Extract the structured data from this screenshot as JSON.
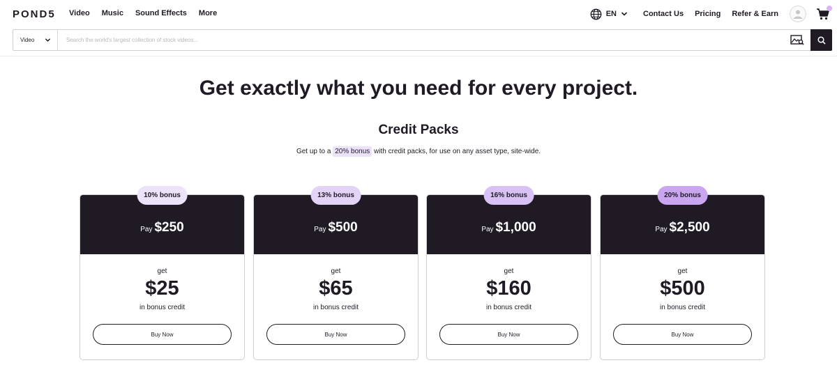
{
  "header": {
    "logo": "POND5",
    "nav": [
      "Video",
      "Music",
      "Sound Effects",
      "More"
    ],
    "language": "EN",
    "links": [
      "Contact Us",
      "Pricing",
      "Refer & Earn"
    ]
  },
  "search": {
    "type": "Video",
    "placeholder": "Search the world's largest collection of stock videos..."
  },
  "main": {
    "title": "Get exactly what you need for every project.",
    "section_title": "Credit Packs",
    "subtitle_pre": "Get up to a ",
    "subtitle_highlight": "20% bonus",
    "subtitle_post": " with credit packs, for use on any asset type, site-wide."
  },
  "cards": [
    {
      "badge": "10% bonus",
      "pay_label": "Pay",
      "pay": "$250",
      "get_label": "get",
      "bonus": "$25",
      "bonus_label": "in bonus credit",
      "button": "Buy Now",
      "badge_color": "#ece3fb"
    },
    {
      "badge": "13% bonus",
      "pay_label": "Pay",
      "pay": "$500",
      "get_label": "get",
      "bonus": "$65",
      "bonus_label": "in bonus credit",
      "button": "Buy Now",
      "badge_color": "#e3d4f7"
    },
    {
      "badge": "16% bonus",
      "pay_label": "Pay",
      "pay": "$1,000",
      "get_label": "get",
      "bonus": "$160",
      "bonus_label": "in bonus credit",
      "button": "Buy Now",
      "badge_color": "#d8c1f4"
    },
    {
      "badge": "20% bonus",
      "pay_label": "Pay",
      "pay": "$2,500",
      "get_label": "get",
      "bonus": "$500",
      "bonus_label": "in bonus credit",
      "button": "Buy Now",
      "badge_color": "#caa6f1"
    }
  ],
  "colors": {
    "dark": "#1f1a24",
    "accent": "#d7b6f3"
  }
}
